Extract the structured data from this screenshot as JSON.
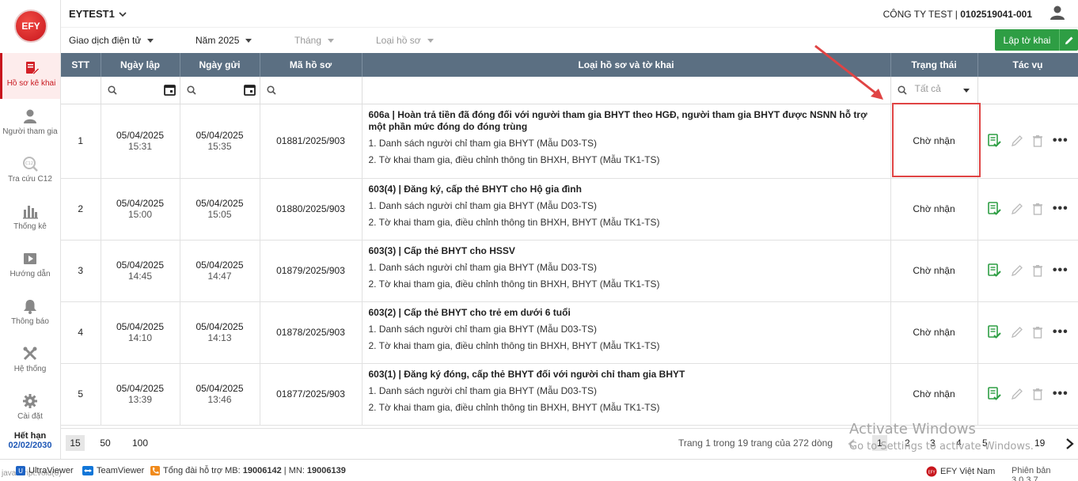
{
  "sidebar": {
    "logo": "EFY",
    "items": [
      {
        "label": "Hồ sơ kê khai",
        "icon": "document-edit-icon"
      },
      {
        "label": "Người tham gia",
        "icon": "person-icon"
      },
      {
        "label": "Tra cứu C12",
        "icon": "search-c12-icon"
      },
      {
        "label": "Thống kê",
        "icon": "bar-chart-icon"
      },
      {
        "label": "Hướng dẫn",
        "icon": "guide-video-icon"
      },
      {
        "label": "Thông báo",
        "icon": "bell-icon"
      },
      {
        "label": "Hệ thống",
        "icon": "tools-icon"
      },
      {
        "label": "Cài đặt",
        "icon": "gear-icon"
      }
    ],
    "expire_label": "Hết hạn",
    "expire_date": "02/02/2030"
  },
  "topbar": {
    "tenant": "EYTEST1",
    "company_name": "CÔNG TY TEST | ",
    "company_code": "0102519041-001"
  },
  "filters": {
    "type": "Giao dịch điện tử",
    "year": "Năm 2025",
    "month": "Tháng",
    "doc_type": "Loại hồ sơ",
    "create_button": "Lập tờ khai"
  },
  "table": {
    "headers": [
      "STT",
      "Ngày lập",
      "Ngày gửi",
      "Mã hồ sơ",
      "Loại hồ sơ và tờ khai",
      "Trạng thái",
      "Tác vụ"
    ],
    "status_filter": "Tất cả",
    "rows": [
      {
        "stt": "1",
        "created_date": "05/04/2025",
        "created_time": "15:31",
        "sent_date": "05/04/2025",
        "sent_time": "15:35",
        "code": "01881/2025/903",
        "title": "606a | Hoàn trả tiền đã đóng đối với người tham gia BHYT theo HGĐ, người tham gia BHYT được NSNN hỗ trợ một phần mức đóng do đóng trùng",
        "line1": "1. Danh sách người chỉ tham gia BHYT (Mẫu D03-TS)",
        "line2": "2. Tờ khai tham gia, điều chỉnh thông tin BHXH, BHYT (Mẫu TK1-TS)",
        "status": "Chờ nhận"
      },
      {
        "stt": "2",
        "created_date": "05/04/2025",
        "created_time": "15:00",
        "sent_date": "05/04/2025",
        "sent_time": "15:05",
        "code": "01880/2025/903",
        "title": "603(4) | Đăng ký, cấp thẻ BHYT cho Hộ gia đình",
        "line1": "1. Danh sách người chỉ tham gia BHYT (Mẫu D03-TS)",
        "line2": "2. Tờ khai tham gia, điều chỉnh thông tin BHXH, BHYT (Mẫu TK1-TS)",
        "status": "Chờ nhận"
      },
      {
        "stt": "3",
        "created_date": "05/04/2025",
        "created_time": "14:45",
        "sent_date": "05/04/2025",
        "sent_time": "14:47",
        "code": "01879/2025/903",
        "title": "603(3) | Cấp thẻ BHYT cho HSSV",
        "line1": "1. Danh sách người chỉ tham gia BHYT (Mẫu D03-TS)",
        "line2": "2. Tờ khai tham gia, điều chỉnh thông tin BHXH, BHYT (Mẫu TK1-TS)",
        "status": "Chờ nhận"
      },
      {
        "stt": "4",
        "created_date": "05/04/2025",
        "created_time": "14:10",
        "sent_date": "05/04/2025",
        "sent_time": "14:13",
        "code": "01878/2025/903",
        "title": "603(2) | Cấp thẻ BHYT cho trẻ em dưới 6 tuổi",
        "line1": "1. Danh sách người chỉ tham gia BHYT (Mẫu D03-TS)",
        "line2": "2. Tờ khai tham gia, điều chỉnh thông tin BHXH, BHYT (Mẫu TK1-TS)",
        "status": "Chờ nhận"
      },
      {
        "stt": "5",
        "created_date": "05/04/2025",
        "created_time": "13:39",
        "sent_date": "05/04/2025",
        "sent_time": "13:46",
        "code": "01877/2025/903",
        "title": "603(1) | Đăng ký đóng, cấp thẻ BHYT đối với người chỉ tham gia BHYT",
        "line1": "1. Danh sách người chỉ tham gia BHYT (Mẫu D03-TS)",
        "line2": "2. Tờ khai tham gia, điều chỉnh thông tin BHXH, BHYT (Mẫu TK1-TS)",
        "status": "Chờ nhận"
      }
    ]
  },
  "pagination": {
    "sizes": [
      "15",
      "50",
      "100"
    ],
    "info": "Trang 1 trong 19 trang của 272 dòng",
    "pages": [
      "1",
      "2",
      "3",
      "4",
      "5",
      "19"
    ]
  },
  "watermark": {
    "line1": "Activate Windows",
    "line2": "Go to Settings to activate Windows."
  },
  "footer": {
    "status_text": "javascript:void(0)",
    "ultraviewer": "UltraViewer",
    "teamviewer": "TeamViewer",
    "support_label": "Tổng đài hỗ trợ MB: ",
    "support_mb": "19006142",
    "support_sep": " | MN: ",
    "support_mn": "19006139",
    "brand": "EFY Việt Nam",
    "version": "Phiên bản 3.0.3.7"
  },
  "colors": {
    "header_bg": "#5b6f82",
    "primary_green": "#2e9e44",
    "brand_red": "#c8161d",
    "highlight_red": "#e04444"
  }
}
